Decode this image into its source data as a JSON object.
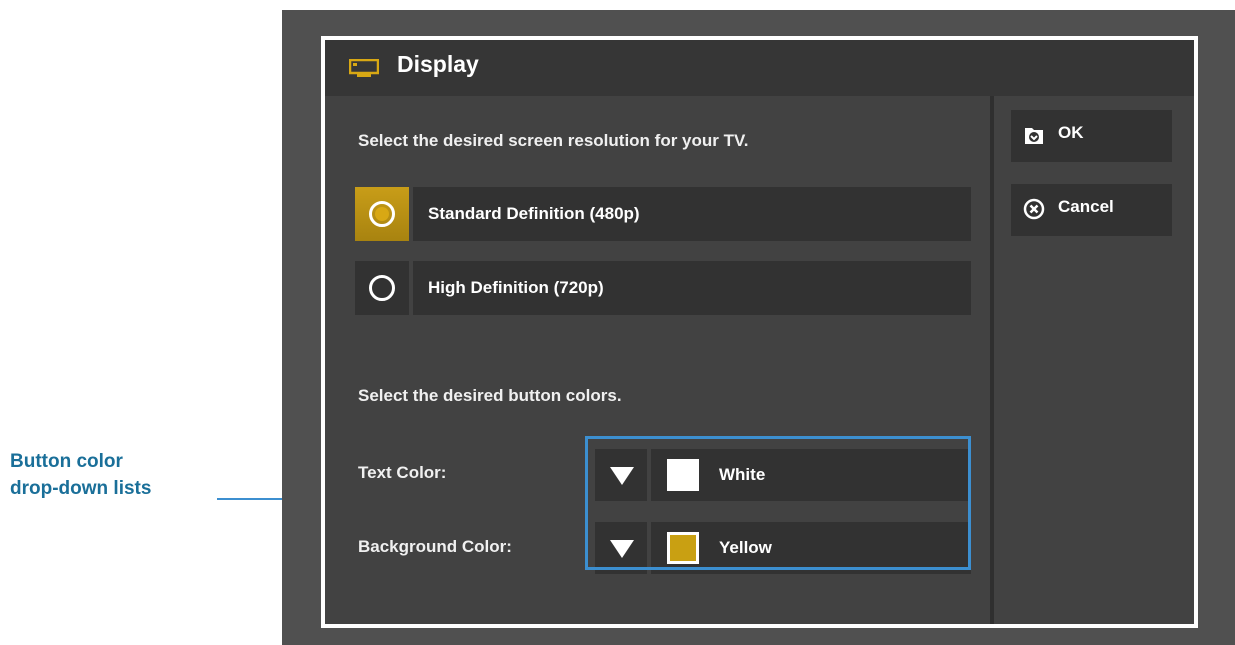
{
  "callout": {
    "line1": "Button color",
    "line2": "drop-down lists"
  },
  "dialog": {
    "title": "Display",
    "title_icon": "tv-icon"
  },
  "resolution": {
    "prompt": "Select the desired screen resolution for your TV.",
    "options": [
      {
        "label": "Standard Definition (480p)",
        "selected": true
      },
      {
        "label": "High Definition (720p)",
        "selected": false
      }
    ]
  },
  "colors": {
    "prompt": "Select the desired button colors.",
    "text_color": {
      "label": "Text Color:",
      "value": "White",
      "swatch": "#ffffff"
    },
    "background_color": {
      "label": "Background Color:",
      "value": "Yellow",
      "swatch": "#c9a012"
    }
  },
  "actions": {
    "ok": {
      "label": "OK",
      "icon": "save-icon"
    },
    "cancel": {
      "label": "Cancel",
      "icon": "cancel-icon"
    }
  },
  "theme": {
    "accent": "#c89d18",
    "callout": "#1a6f99",
    "highlight_box": "#3c8fd0"
  }
}
